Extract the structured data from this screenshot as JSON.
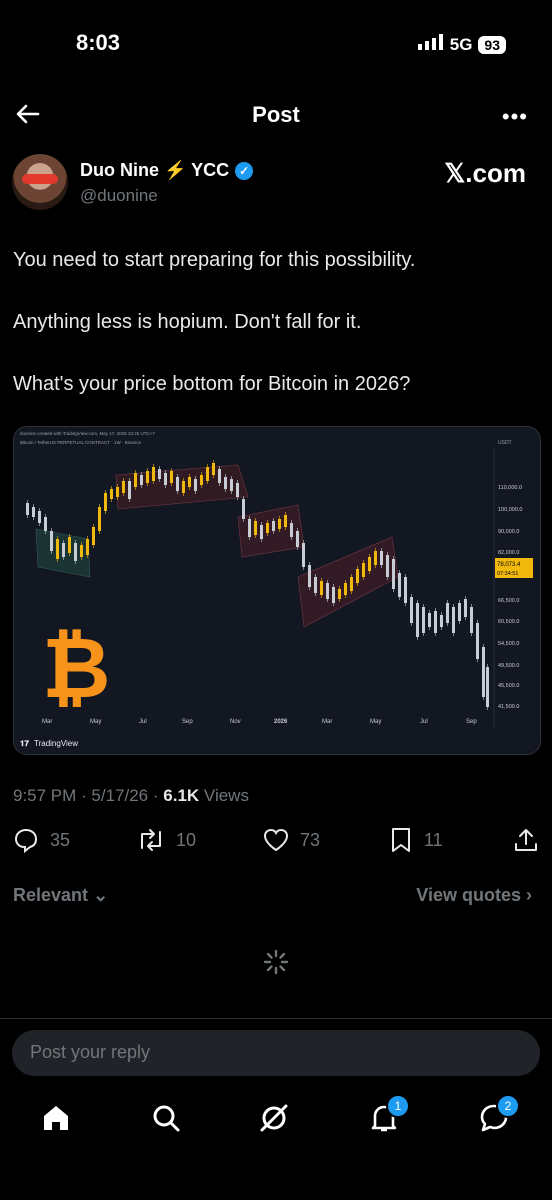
{
  "status_bar": {
    "time": "8:03",
    "network": "5G",
    "battery": "93"
  },
  "header": {
    "title": "Post"
  },
  "author": {
    "name": "Duo Nine ⚡ YCC",
    "handle": "@duonine",
    "brand": "𝕏.com"
  },
  "post": {
    "lines": [
      "You need to start preparing for this possibility.",
      "Anything less is hopium. Don't fall for it.",
      "What's your price bottom for Bitcoin in 2026?"
    ],
    "time": "9:57 PM",
    "date": "5/17/26",
    "views_count": "6.1K",
    "views_label": "Views"
  },
  "chart_image": {
    "top_note": "duonine created with TradingView.com, May 17, 2026 23:25 UTC+7",
    "symbol_line": "Bitcoin / TetherUS PERPETUAL CONTRACT · 1W · Binance",
    "currency": "USDT",
    "price_ticks": [
      "110,000.0",
      "100,000.0",
      "90,000.0",
      "82,000.0",
      "66,500.0",
      "60,500.0",
      "54,500.0",
      "49,500.0",
      "45,500.0",
      "41,500.0"
    ],
    "current_price": "78,073.4",
    "countdown": "07:34:51",
    "x_ticks": [
      "Mar",
      "May",
      "Jul",
      "Sep",
      "Nov",
      "2026",
      "Mar",
      "May",
      "Jul",
      "Sep"
    ],
    "logo_text": "TradingView",
    "bitcoin_symbol": "₿"
  },
  "actions": {
    "replies": "35",
    "reposts": "10",
    "likes": "73",
    "bookmarks": "11"
  },
  "sort": {
    "relevant": "Relevant",
    "view_quotes": "View quotes"
  },
  "reply": {
    "placeholder": "Post your reply"
  },
  "nav": {
    "notifications_badge": "1",
    "messages_badge": "2"
  },
  "colors": {
    "accent": "#1d9bf0",
    "candle_up": "#f0b90b",
    "candle_down": "#c8ccd4",
    "bitcoin": "#f7931a"
  }
}
